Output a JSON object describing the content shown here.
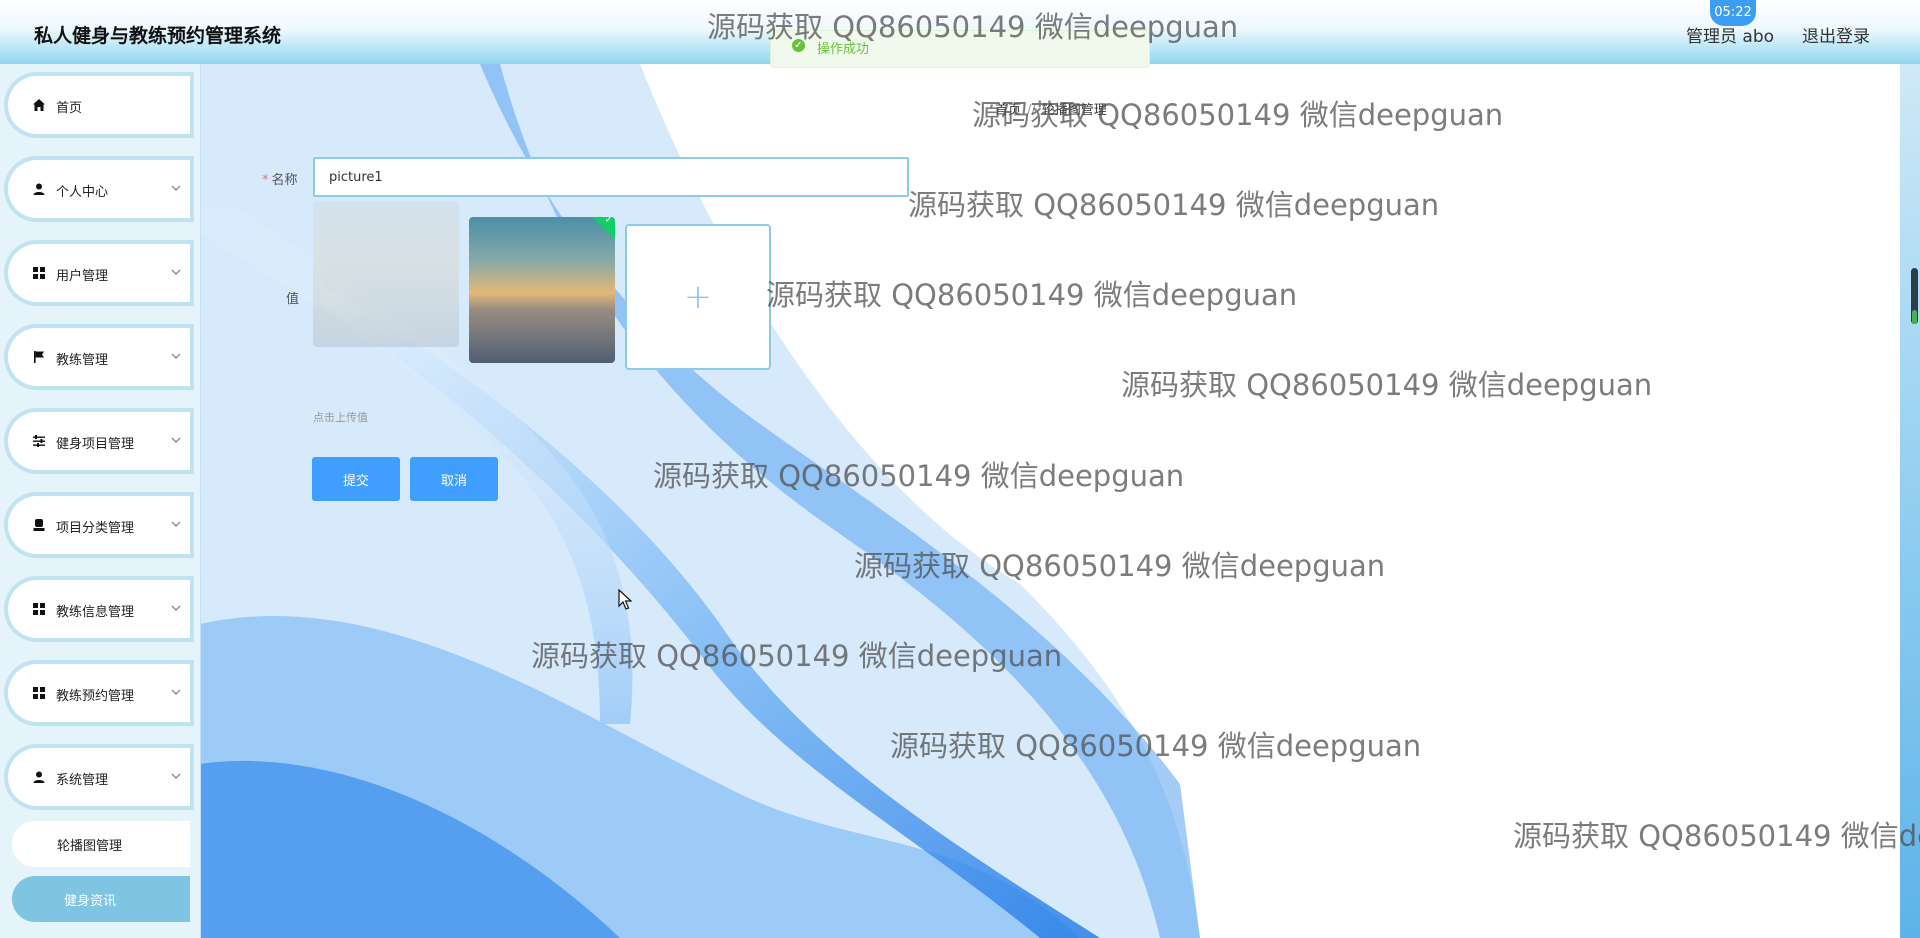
{
  "header": {
    "title": "私人健身与教练预约管理系统",
    "user_label": "管理员 abo",
    "logout_label": "退出登录",
    "clock": "05:22"
  },
  "toast": {
    "text": "操作成功"
  },
  "sidebar": {
    "items": [
      {
        "label": "首页",
        "icon": "home-icon"
      },
      {
        "label": "个人中心",
        "icon": "user-icon"
      },
      {
        "label": "用户管理",
        "icon": "grid-icon"
      },
      {
        "label": "教练管理",
        "icon": "flag-icon"
      },
      {
        "label": "健身项目管理",
        "icon": "sliders-icon"
      },
      {
        "label": "项目分类管理",
        "icon": "stamp-icon"
      },
      {
        "label": "教练信息管理",
        "icon": "grid-icon"
      },
      {
        "label": "教练预约管理",
        "icon": "grid-icon"
      },
      {
        "label": "系统管理",
        "icon": "user-icon"
      }
    ],
    "sub_items": [
      {
        "label": "轮播图管理"
      },
      {
        "label": "健身资讯"
      }
    ]
  },
  "breadcrumb": {
    "home": "首页",
    "separator": "//",
    "current": "轮播图管理"
  },
  "form": {
    "name_label": "名称",
    "name_value": "picture1",
    "value_label": "值",
    "upload_tip": "点击上传值",
    "upload_plus": "+",
    "submit_label": "提交",
    "cancel_label": "取消"
  },
  "watermark": {
    "text": "源码获取 QQ86050149 微信deepguan"
  },
  "colors": {
    "primary": "#409eff",
    "success": "#67c23a",
    "header_accent": "#8fd6ee",
    "sidebar_active": "#7fc4e3"
  }
}
